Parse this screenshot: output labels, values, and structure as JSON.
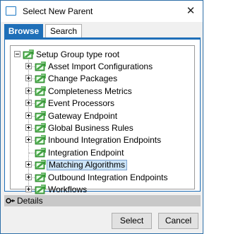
{
  "window": {
    "title": "Select New Parent",
    "close_glyph": "✕"
  },
  "tabs": [
    {
      "label": "Browse",
      "active": true
    },
    {
      "label": "Search",
      "active": false
    }
  ],
  "tree": {
    "root": {
      "label": "Setup Group type root",
      "expanded": true,
      "icon": "folder-icon"
    },
    "children": [
      {
        "label": "Asset Import Configurations",
        "expandable": true,
        "selected": false
      },
      {
        "label": "Change Packages",
        "expandable": true,
        "selected": false
      },
      {
        "label": "Completeness Metrics",
        "expandable": true,
        "selected": false
      },
      {
        "label": "Event Processors",
        "expandable": true,
        "selected": false
      },
      {
        "label": "Gateway Endpoint",
        "expandable": true,
        "selected": false
      },
      {
        "label": "Global Business Rules",
        "expandable": true,
        "selected": false
      },
      {
        "label": "Inbound Integration Endpoints",
        "expandable": true,
        "selected": false
      },
      {
        "label": "Integration Endpoint",
        "expandable": false,
        "selected": false
      },
      {
        "label": "Matching Algorithms",
        "expandable": true,
        "selected": true
      },
      {
        "label": "Outbound Integration Endpoints",
        "expandable": true,
        "selected": false
      },
      {
        "label": "Workflows",
        "expandable": true,
        "selected": false
      }
    ]
  },
  "details": {
    "label": "Details",
    "icon": "expand-arrow-icon"
  },
  "buttons": {
    "select": "Select",
    "cancel": "Cancel"
  },
  "colors": {
    "accent": "#1f6fb8",
    "selection": "#cce4f7",
    "folder_green": "#3ea93e"
  }
}
